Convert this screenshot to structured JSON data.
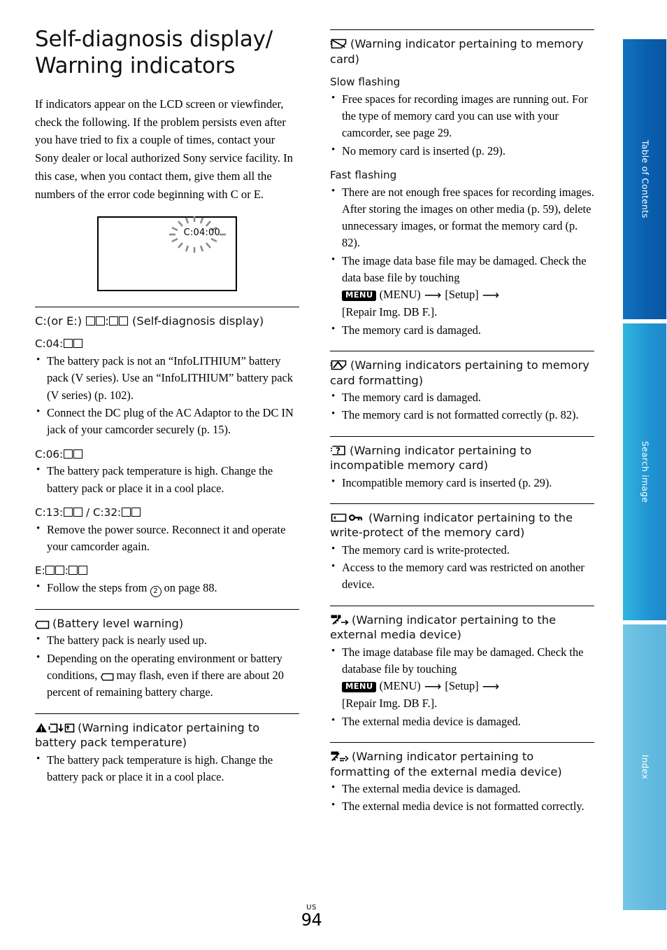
{
  "page": {
    "title_line1": "Self-diagnosis display/",
    "title_line2": "Warning indicators",
    "intro": "If indicators appear on the LCD screen or viewfinder, check the following. If the problem persists even after you have tried to fix a couple of times, contact your Sony dealer or local authorized Sony service facility. In this case, when you contact them, give them all the numbers of the error code beginning with C or E.",
    "lcd_code": "C:04:00",
    "footer_region": "US",
    "footer_page": "94"
  },
  "tabs": [
    {
      "label": "Table of Contents",
      "color": "#0a5fae"
    },
    {
      "label": "Search image",
      "color": "#1f94d2"
    },
    {
      "label": "Index",
      "color": "#63bbe0"
    }
  ],
  "left_column": {
    "selfdiag": {
      "heading_prefix": "C:(or E:) ",
      "heading_suffix": " (Self-diagnosis display)",
      "groups": [
        {
          "label_prefix": "C:04:",
          "bullets": [
            "The battery pack is not an “InfoLITHIUM” battery pack (V series). Use an “InfoLITHIUM” battery pack (V series) (p. 102).",
            "Connect the DC plug of the AC Adaptor to the DC IN jack of your camcorder securely (p. 15)."
          ]
        },
        {
          "label_prefix": "C:06:",
          "bullets": [
            "The battery pack temperature is high. Change the battery pack or place it in a cool place."
          ]
        },
        {
          "label_prefix": "C:13:",
          "label_mid": " / C:32:",
          "bullets": [
            "Remove the power source. Reconnect it and operate your camcorder again."
          ]
        },
        {
          "label_prefix": "E:",
          "bullets_html": "Follow the steps from (2) on page 88."
        }
      ]
    },
    "battery_warning": {
      "icon": "battery-icon",
      "heading": "(Battery level warning)",
      "bullets": [
        "The battery pack is nearly used up.",
        "Depending on the operating environment or battery conditions, [battery-icon] may flash, even if there are about 20 percent of remaining battery charge."
      ]
    },
    "battery_temp": {
      "icon": "warning-battery-temperature-icon",
      "heading": "(Warning indicator pertaining to battery pack temperature)",
      "bullets": [
        "The battery pack temperature is high. Change the battery pack or place it in a cool place."
      ]
    }
  },
  "right_column": {
    "memory_card": {
      "icon": "memory-card-warning-icon",
      "heading": "(Warning indicator pertaining to memory card)",
      "sub1": "Slow flashing",
      "sub1_bullets": [
        "Free spaces for recording images are running out. For the type of memory card you can use with your camcorder, see page 29.",
        "No memory card is inserted (p. 29)."
      ],
      "sub2": "Fast flashing",
      "sub2_bullets": [
        "There are not enough free spaces for recording images. After storing the images on other media (p. 59), delete unnecessary images, or format the memory card (p. 82).",
        "The image data base file may be damaged. Check the data base file by touching [MENU] (MENU) → [Setup] → [Repair Img. DB F.].",
        "The memory card is damaged."
      ],
      "menu_badge": "MENU",
      "menu_text": "(MENU)",
      "setup_text": "[Setup]",
      "repair_text": "[Repair Img. DB F.]."
    },
    "card_format": {
      "icon": "memory-card-format-warning-icon",
      "heading": "(Warning indicators pertaining to memory card formatting)",
      "bullets": [
        "The memory card is damaged.",
        "The memory card is not formatted correctly (p. 82)."
      ]
    },
    "incompatible_card": {
      "icon": "incompatible-memory-card-icon",
      "heading": "(Warning indicator pertaining to incompatible memory card)",
      "bullets": [
        "Incompatible memory card is inserted (p. 29)."
      ]
    },
    "write_protect": {
      "icon": "memory-card-key-icon",
      "heading": "(Warning indicator pertaining to the write-protect of the memory card)",
      "bullets": [
        "The memory card is write-protected.",
        "Access to the memory card was restricted on another device."
      ]
    },
    "external_media": {
      "icon": "external-media-warning-icon",
      "heading": "(Warning indicator pertaining to the external media device)",
      "bullets": [
        "The image database file may be damaged. Check the database file by touching [MENU] (MENU) → [Setup] → [Repair Img. DB F.].",
        "The external media device is damaged."
      ],
      "menu_badge": "MENU",
      "menu_text": "(MENU)",
      "setup_text": "[Setup]",
      "repair_text": "[Repair Img. DB F.]."
    },
    "external_format": {
      "icon": "external-media-format-warning-icon",
      "heading": "(Warning indicator pertaining to formatting of the external media device)",
      "bullets": [
        "The external media device is damaged.",
        "The external media device is not formatted correctly."
      ]
    }
  }
}
